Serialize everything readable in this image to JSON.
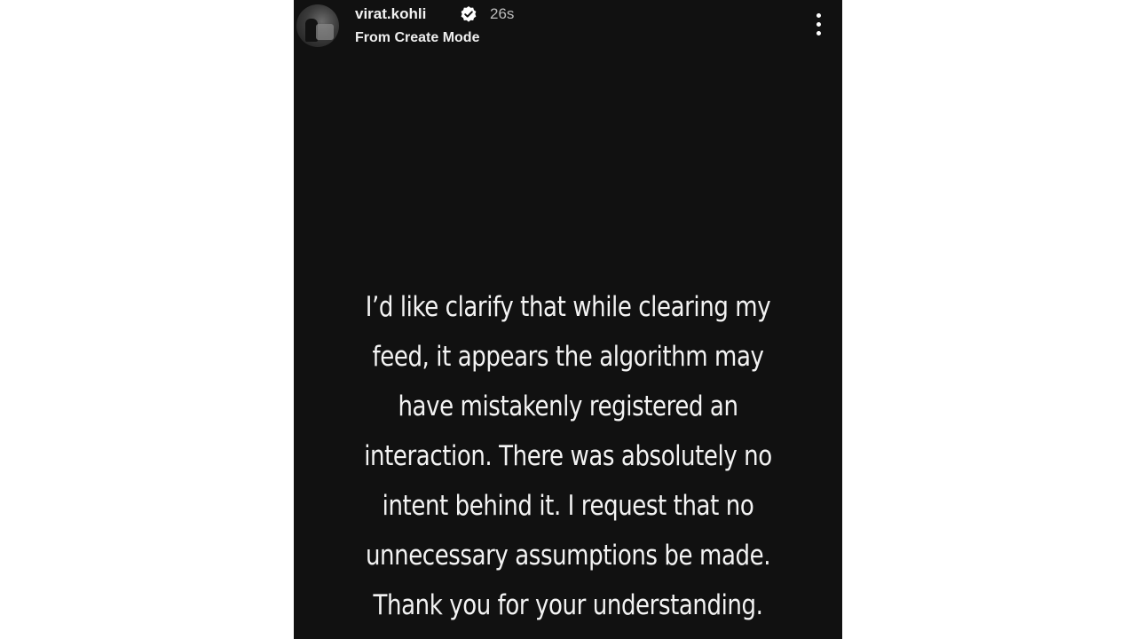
{
  "story": {
    "username": "virat.kohli",
    "time": "26s",
    "subtitle": "From Create Mode",
    "verified_icon": "verified-badge-icon",
    "more_icon": "more-vertical-icon",
    "message_lines": [
      "I’d like clarify that while clearing my",
      "feed, it appears the algorithm may",
      "have mistakenly registered an",
      "interaction. There was absolutely no",
      "intent behind it. I request that no",
      "unnecessary assumptions be made.",
      "Thank you for your understanding."
    ]
  },
  "colors": {
    "background": "#111111",
    "page": "#ffffff",
    "text": "#f3f3f3"
  }
}
